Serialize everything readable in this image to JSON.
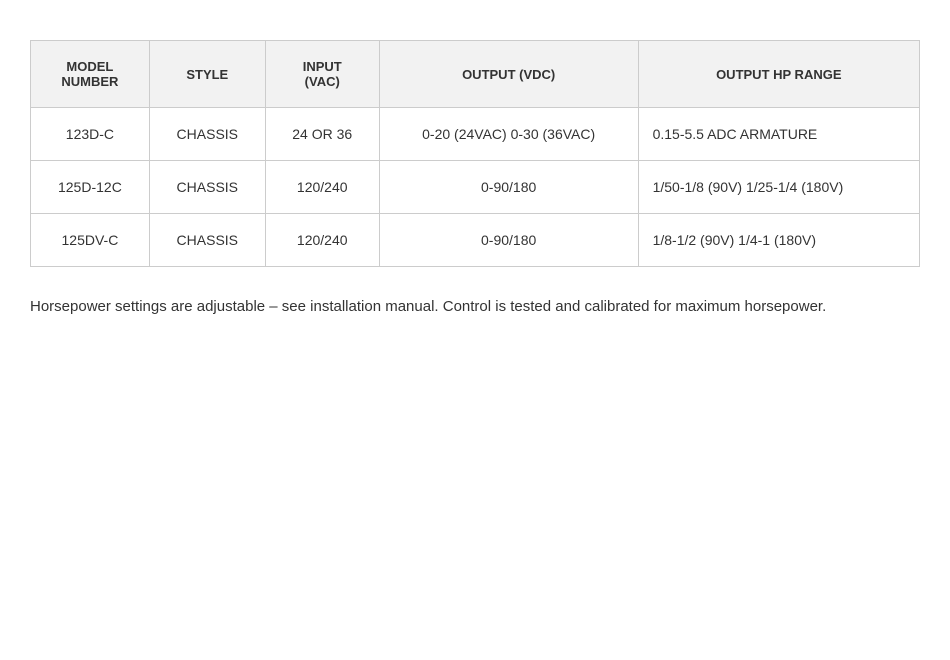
{
  "table": {
    "headers": [
      {
        "id": "model-number",
        "label": "MODEL\nNUMBER"
      },
      {
        "id": "style",
        "label": "STYLE"
      },
      {
        "id": "input-vac",
        "label": "INPUT\n(VAC)"
      },
      {
        "id": "output-vdc",
        "label": "OUTPUT (VDC)"
      },
      {
        "id": "output-hp-range",
        "label": "OUTPUT HP RANGE"
      }
    ],
    "rows": [
      {
        "model": "123D-C",
        "style": "CHASSIS",
        "input": "24 OR 36",
        "output_vdc": "0-20 (24VAC) 0-30 (36VAC)",
        "output_hp": "0.15-5.5 ADC ARMATURE"
      },
      {
        "model": "125D-12C",
        "style": "CHASSIS",
        "input": "120/240",
        "output_vdc": "0-90/180",
        "output_hp": "1/50-1/8 (90V) 1/25-1/4 (180V)"
      },
      {
        "model": "125DV-C",
        "style": "CHASSIS",
        "input": "120/240",
        "output_vdc": "0-90/180",
        "output_hp": "1/8-1/2 (90V) 1/4-1 (180V)"
      }
    ]
  },
  "footer": {
    "text": "Horsepower settings are adjustable – see installation manual. Control is tested and calibrated for maximum horsepower."
  }
}
